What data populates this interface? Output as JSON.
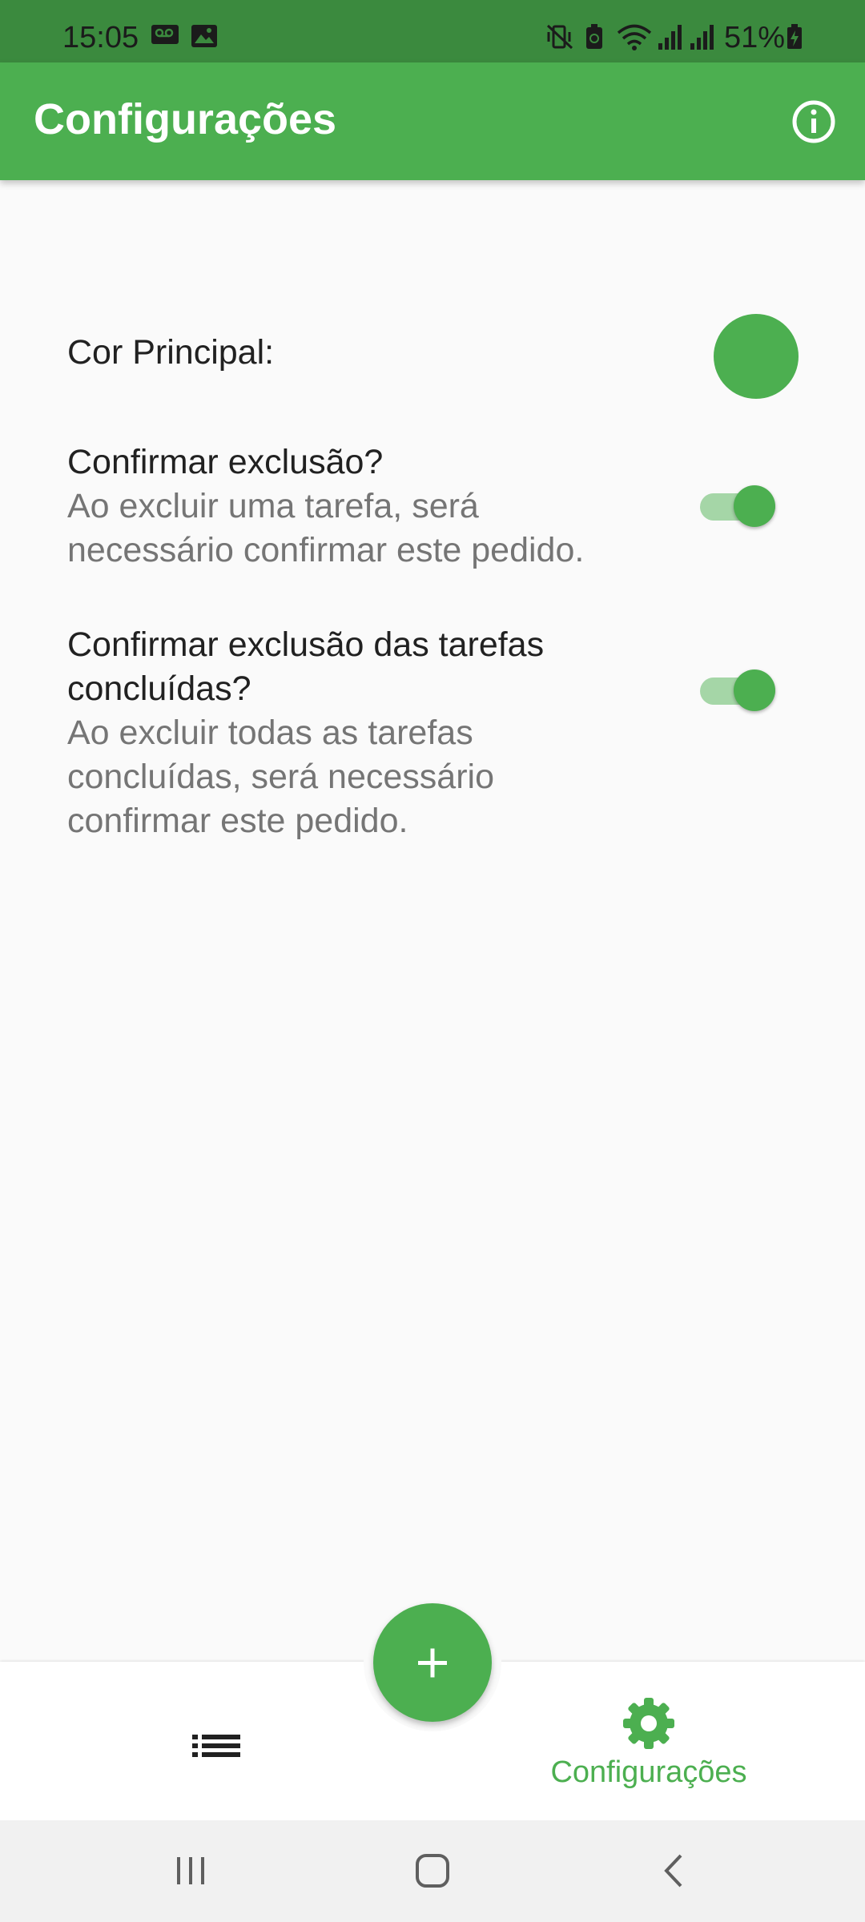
{
  "status_bar": {
    "time": "15:05",
    "battery_percent": "51%",
    "icons": [
      "voicemail-icon",
      "image-icon",
      "vibrate-icon",
      "battery-saver-icon",
      "wifi-icon",
      "signal-icon",
      "signal-icon",
      "battery-icon"
    ]
  },
  "app_bar": {
    "title": "Configurações",
    "info_icon": "info-icon",
    "color": "#4CAF50"
  },
  "settings": {
    "main_color": {
      "label": "Cor Principal:",
      "color": "#4CAF50"
    },
    "confirm_delete": {
      "title": "Confirmar exclusão?",
      "subtitle_line1": "Ao excluir uma tarefa, será",
      "subtitle_line2": "necessário confirmar este pedido.",
      "enabled": true
    },
    "confirm_delete_completed": {
      "title_line1": "Confirmar exclusão das tarefas",
      "title_line2": "concluídas?",
      "subtitle_line1": "Ao excluir todas as tarefas",
      "subtitle_line2": "concluídas, será necessário",
      "subtitle_line3": "confirmar este pedido.",
      "enabled": true
    }
  },
  "fab": {
    "icon": "plus-icon"
  },
  "bottom_nav": {
    "items": [
      {
        "icon": "list-icon",
        "label": ""
      },
      {
        "icon": "gear-icon",
        "label": "Configurações",
        "active": true
      }
    ]
  },
  "system_nav": {
    "buttons": [
      "recents-icon",
      "home-icon",
      "back-icon"
    ]
  }
}
